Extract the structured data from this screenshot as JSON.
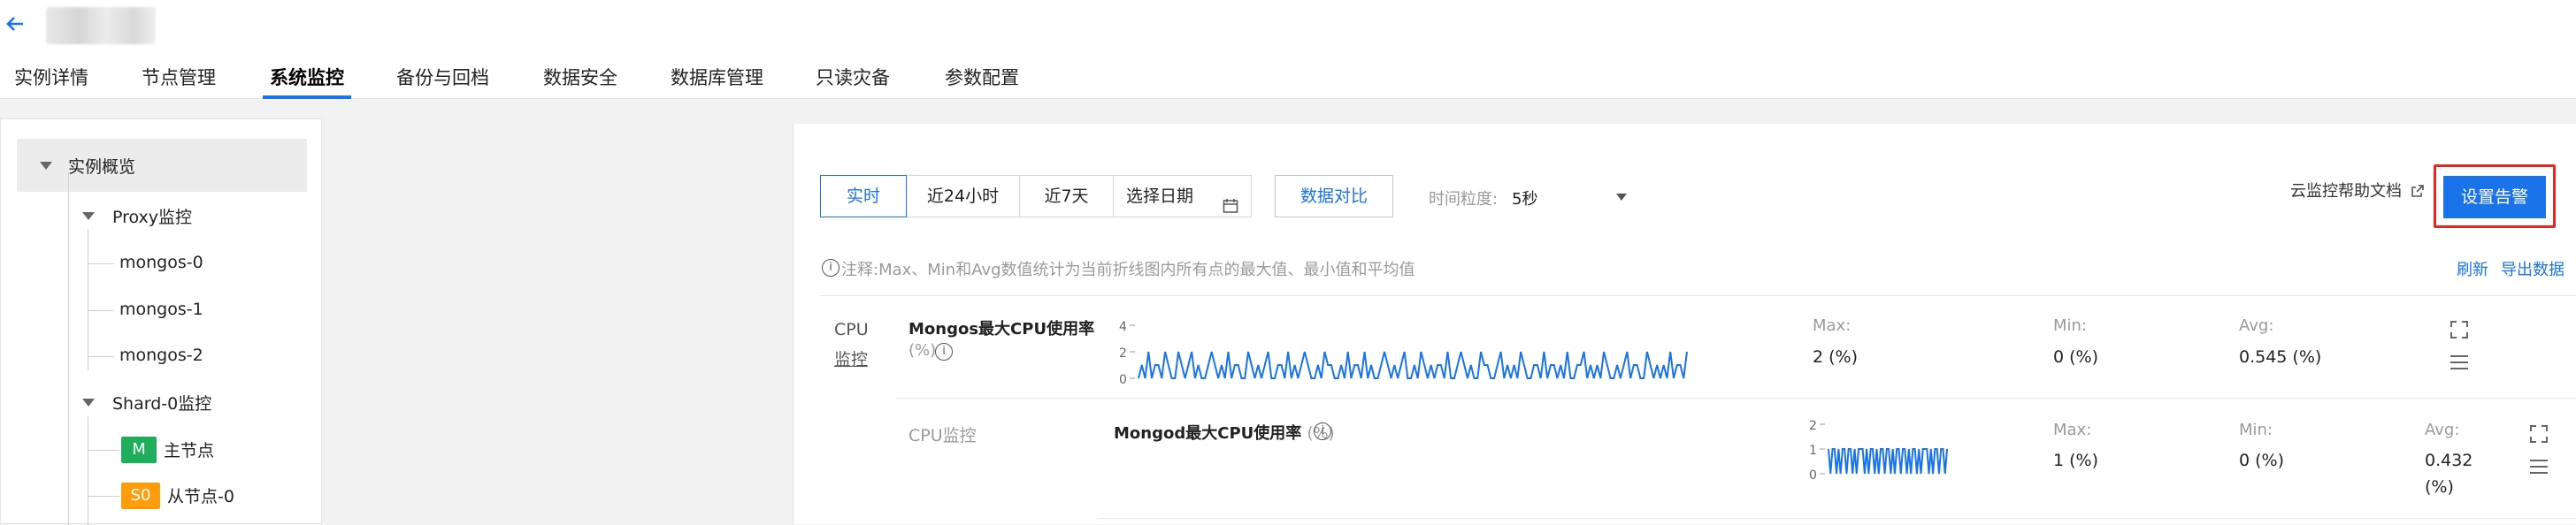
{
  "header": {
    "tabs": [
      {
        "label": "实例详情"
      },
      {
        "label": "节点管理"
      },
      {
        "label": "系统监控"
      },
      {
        "label": "备份与回档"
      },
      {
        "label": "数据安全"
      },
      {
        "label": "数据库管理"
      },
      {
        "label": "只读灾备"
      },
      {
        "label": "参数配置"
      }
    ],
    "active_tab": "系统监控"
  },
  "sidebar": {
    "root": "实例概览",
    "proxy_group": "Proxy监控",
    "proxy_items": [
      "mongos-0",
      "mongos-1",
      "mongos-2"
    ],
    "shard_group": "Shard-0监控",
    "shard_items": [
      {
        "badge": "M",
        "label": "主节点",
        "color": "#1fae5b"
      },
      {
        "badge": "S0",
        "label": "从节点-0",
        "color": "#ff9c0a"
      }
    ]
  },
  "toolbar": {
    "realtime": "实时",
    "last24h": "近24小时",
    "last7d": "近7天",
    "pick_date": "选择日期",
    "compare": "数据对比",
    "granularity_label": "时间粒度:",
    "granularity_value": "5秒",
    "help_doc": "云监控帮助文档",
    "set_alarm": "设置告警"
  },
  "notice": {
    "text": "注释:Max、Min和Avg数值统计为当前折线图内所有点的最大值、最小值和平均值",
    "refresh": "刷新",
    "export": "导出数据"
  },
  "metrics": {
    "section_line1": "CPU",
    "section_line2": "监控",
    "row1": {
      "title": "Mongos最大CPU使用率",
      "unit": "(%)",
      "max_label": "Max:",
      "max_value": "2 (%)",
      "min_label": "Min:",
      "min_value": "0 (%)",
      "avg_label": "Avg:",
      "avg_value": "0.545 (%)"
    },
    "row2": {
      "group": "CPU监控",
      "title": "Mongod最大CPU使用率",
      "unit": "(%)",
      "max_label": "Max:",
      "max_value": "1 (%)",
      "min_label": "Min:",
      "min_value": "0 (%)",
      "avg_label": "Avg:",
      "avg_value": "0.432",
      "avg_unit": "(%)"
    }
  },
  "chart_data": [
    {
      "type": "line",
      "title": "Mongos最大CPU使用率",
      "ylim": [
        0,
        4
      ],
      "yticks": [
        "4",
        "2",
        "0"
      ],
      "color": "#1a73e8",
      "series": [
        {
          "values": [
            0,
            1,
            0,
            2,
            0,
            1,
            1,
            0,
            2,
            1,
            0,
            0,
            2,
            1,
            0,
            1,
            2,
            0,
            1,
            0,
            0,
            1,
            2,
            1,
            0,
            1,
            0,
            2,
            0,
            1,
            1,
            0,
            0,
            2,
            1,
            0,
            1,
            0,
            1,
            2,
            0,
            0,
            1,
            1,
            0,
            2,
            0,
            1,
            0,
            1,
            2,
            1,
            0,
            0,
            1,
            0,
            2,
            1,
            1,
            0,
            0,
            1,
            0,
            2,
            0,
            1,
            1,
            0,
            2,
            0,
            1,
            0,
            0,
            1,
            2,
            1,
            0,
            1,
            0,
            1,
            2,
            0,
            0,
            1,
            0,
            2,
            1,
            0,
            1,
            0,
            1,
            1,
            0,
            2,
            0,
            0,
            1,
            2,
            1,
            0,
            1,
            0,
            0,
            2,
            1,
            1,
            0,
            0,
            1,
            2,
            0,
            1,
            0,
            1,
            0,
            2,
            1,
            0,
            0,
            1,
            1,
            0,
            2,
            0,
            1,
            1,
            0,
            1,
            0,
            2,
            0,
            0,
            1,
            1,
            2,
            0,
            1,
            0,
            1,
            0,
            2,
            1,
            0,
            0,
            1,
            0,
            1,
            2,
            0,
            1,
            1,
            0,
            0,
            2,
            1,
            0,
            1,
            0,
            1,
            0,
            2,
            0,
            1,
            1,
            0,
            2
          ]
        }
      ]
    },
    {
      "type": "line",
      "title": "Mongod最大CPU使用率",
      "ylim": [
        0,
        2
      ],
      "yticks": [
        "2",
        "1",
        "0"
      ],
      "color": "#1a73e8",
      "series": [
        {
          "values": [
            1,
            0,
            1,
            1,
            0,
            1,
            0,
            1,
            1,
            0,
            1,
            1,
            0,
            1,
            0,
            1,
            1,
            1,
            0,
            1,
            0,
            1,
            1,
            0,
            1,
            0,
            1,
            1,
            0,
            1,
            1,
            0,
            1,
            0,
            1,
            1,
            0,
            1,
            1,
            0,
            1,
            0,
            1,
            1,
            0,
            1,
            0,
            1,
            1,
            1,
            0,
            1,
            0,
            1,
            1,
            0,
            1,
            1,
            0,
            1
          ]
        }
      ]
    }
  ]
}
